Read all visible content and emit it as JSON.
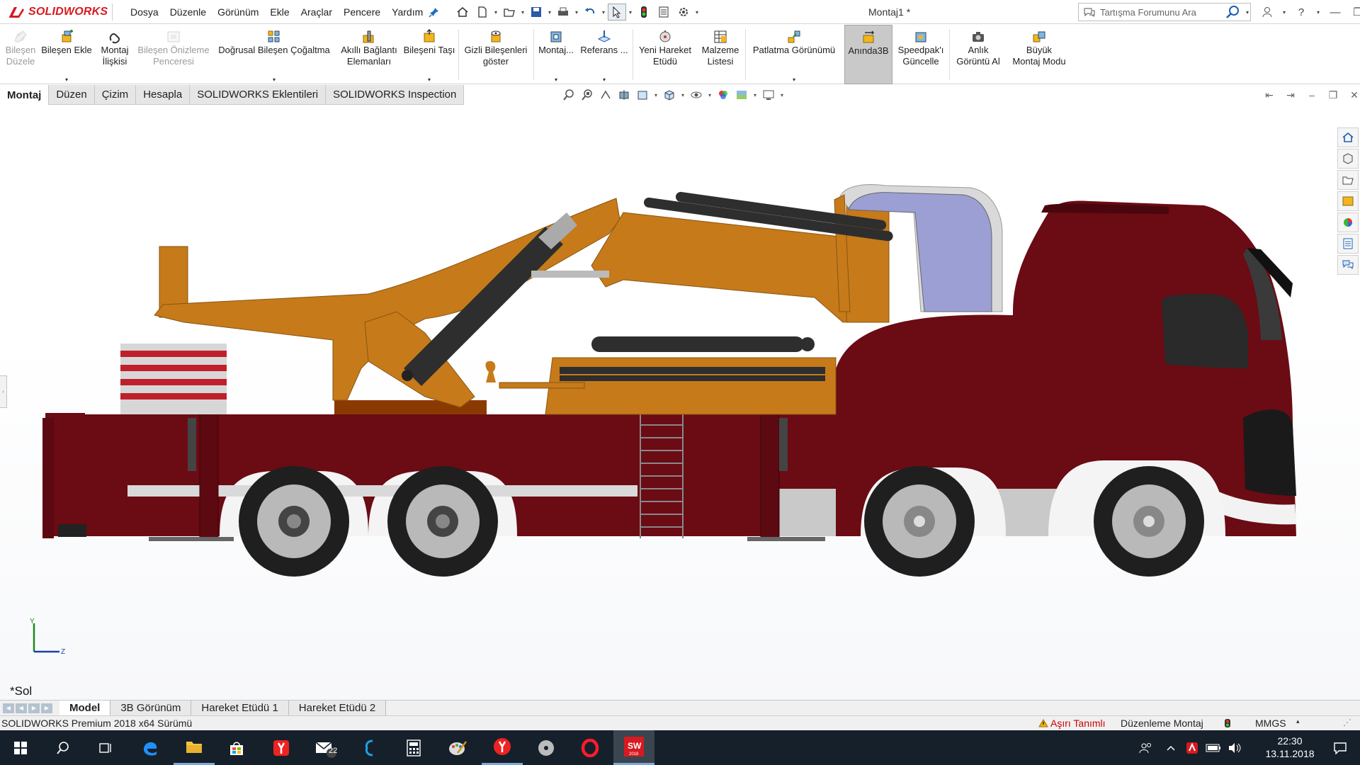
{
  "app": {
    "brand": "SOLIDWORKS",
    "document_title": "Montaj1 *",
    "menu": [
      "Dosya",
      "Düzenle",
      "Görünüm",
      "Ekle",
      "Araçlar",
      "Pencere",
      "Yardım"
    ],
    "search_placeholder": "Tartışma Forumunu Ara",
    "help_label": "?"
  },
  "command_manager": {
    "items": [
      {
        "label": "Bileşen\nDüzele",
        "icon": "edit-component-icon",
        "enabled": false
      },
      {
        "label": "Bileşen Ekle",
        "icon": "insert-component-icon",
        "enabled": true
      },
      {
        "label": "Montaj\nİlişkisi",
        "icon": "mate-icon",
        "enabled": true
      },
      {
        "label": "Bileşen Önizleme\nPenceresi",
        "icon": "component-preview-icon",
        "enabled": false
      },
      {
        "label": "Doğrusal Bileşen Çoğaltma",
        "icon": "linear-pattern-icon",
        "enabled": true
      },
      {
        "label": "Akıllı Bağlantı\nElemanları",
        "icon": "smart-fasteners-icon",
        "enabled": true
      },
      {
        "label": "Bileşeni Taşı",
        "icon": "move-component-icon",
        "enabled": true
      },
      {
        "label": "Gizli Bileşenleri\ngöster",
        "icon": "show-hidden-icon",
        "enabled": true
      },
      {
        "label": "Montaj...",
        "icon": "assembly-features-icon",
        "enabled": true
      },
      {
        "label": "Referans ...",
        "icon": "reference-geometry-icon",
        "enabled": true
      },
      {
        "label": "Yeni Hareket\nEtüdü",
        "icon": "motion-study-icon",
        "enabled": true
      },
      {
        "label": "Malzeme\nListesi",
        "icon": "bill-of-materials-icon",
        "enabled": true
      },
      {
        "label": "Patlatma Görünümü",
        "icon": "exploded-view-icon",
        "enabled": true
      },
      {
        "label": "Anında3B",
        "icon": "instant3d-icon",
        "enabled": true,
        "active": true
      },
      {
        "label": "Speedpak'ı\nGüncelle",
        "icon": "speedpak-icon",
        "enabled": true
      },
      {
        "label": "Anlık\nGörüntü Al",
        "icon": "snapshot-icon",
        "enabled": true
      },
      {
        "label": "Büyük\nMontaj Modu",
        "icon": "large-assembly-icon",
        "enabled": true
      }
    ]
  },
  "cm_tabs": [
    {
      "label": "Montaj",
      "active": true
    },
    {
      "label": "Düzen",
      "active": false
    },
    {
      "label": "Çizim",
      "active": false
    },
    {
      "label": "Hesapla",
      "active": false
    },
    {
      "label": "SOLIDWORKS Eklentileri",
      "active": false
    },
    {
      "label": "SOLIDWORKS Inspection",
      "active": false
    }
  ],
  "viewport": {
    "view_name": "*Sol",
    "triad": {
      "y": "Y",
      "z": "Z"
    },
    "colors": {
      "crane": "#c67a1a",
      "body": "#6b0b14",
      "cylinder": "#2e2e2e",
      "tire": "#1f1f1f",
      "rim": "#b9b9b9",
      "glass": "#9b9fd4"
    }
  },
  "model_tabs": [
    {
      "label": "Model",
      "active": true
    },
    {
      "label": "3B Görünüm",
      "active": false
    },
    {
      "label": "Hareket Etüdü 1",
      "active": false
    },
    {
      "label": "Hareket Etüdü 2",
      "active": false
    }
  ],
  "status": {
    "version": "SOLIDWORKS Premium 2018 x64 Sürümü",
    "warning": "Aşırı Tanımlı",
    "mode": "Düzenleme Montaj",
    "units": "MMGS"
  },
  "taskbar": {
    "mail_badge": "22",
    "time": "22:30",
    "date": "13.11.2018",
    "sw_badge": "2018"
  }
}
